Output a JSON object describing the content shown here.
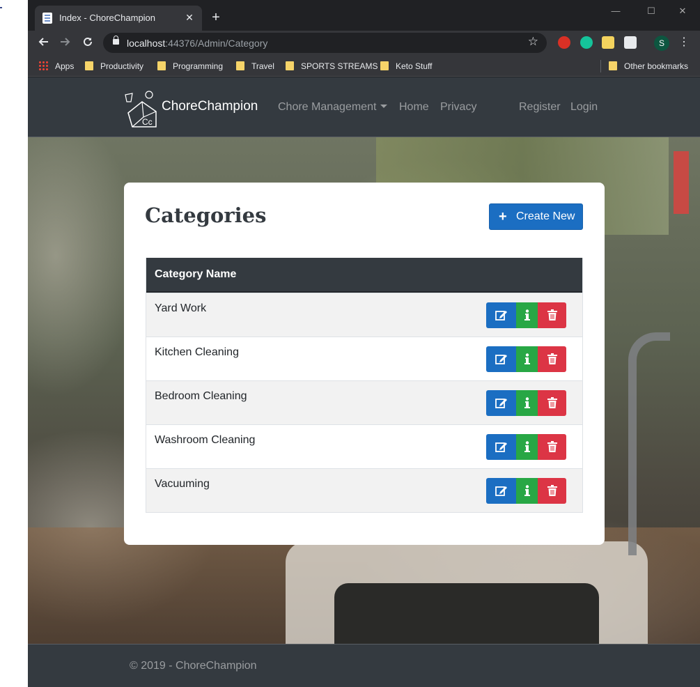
{
  "browser": {
    "tab_title": "Index - ChoreChampion",
    "tab_close": "✕",
    "new_tab": "+",
    "window_controls": {
      "minimize": "—",
      "maximize": "☐",
      "close": "✕"
    },
    "url_host": "localhost",
    "url_rest": ":44376/Admin/Category",
    "profile_initial": "S",
    "extension_colors": [
      "#d93025",
      "#15c39a",
      "#f4d35e",
      "#e8eaed"
    ],
    "bookmarks": [
      {
        "label": "Apps",
        "icon": "apps-grid-icon"
      },
      {
        "label": "Productivity",
        "icon": "folder-icon"
      },
      {
        "label": "Programming",
        "icon": "folder-icon"
      },
      {
        "label": "Travel",
        "icon": "folder-icon"
      },
      {
        "label": "SPORTS STREAMS",
        "icon": "folder-icon"
      },
      {
        "label": "Keto Stuff",
        "icon": "folder-icon"
      }
    ],
    "other_bookmarks": "Other bookmarks"
  },
  "site": {
    "brand": "ChoreChampion",
    "logo_letters": "Cc",
    "nav": {
      "chore_management": "Chore Management",
      "home": "Home",
      "privacy": "Privacy",
      "register": "Register",
      "login": "Login"
    }
  },
  "page": {
    "title": "Categories",
    "create_button": "Create New",
    "table": {
      "header": "Category Name",
      "rows": [
        {
          "name": "Yard Work"
        },
        {
          "name": "Kitchen Cleaning"
        },
        {
          "name": "Bedroom Cleaning"
        },
        {
          "name": "Washroom Cleaning"
        },
        {
          "name": "Vacuuming"
        }
      ],
      "action_icons": [
        "edit-icon",
        "info-icon",
        "trash-icon"
      ]
    }
  },
  "footer": {
    "text": "© 2019 - ChoreChampion"
  },
  "colors": {
    "navbar": "#343a40",
    "primary": "#1b6ec2",
    "success": "#28a745",
    "danger": "#dc3545"
  }
}
